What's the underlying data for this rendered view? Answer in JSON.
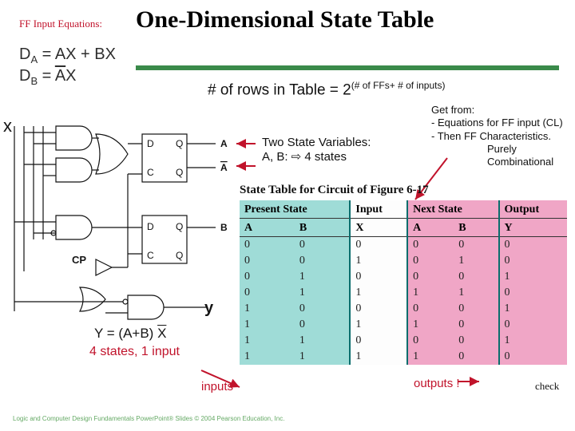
{
  "title": "One-Dimensional State Table",
  "ff_label": "FF Input Equations:",
  "equations": {
    "line1_pre": "D",
    "line1_sub": "A",
    "line1_post": " = AX + BX",
    "line2_pre": "D",
    "line2_sub": "B",
    "line2_eq": " = ",
    "line2_over": "A",
    "line2_end": "X"
  },
  "rows_line": {
    "pre": "# of rows in Table = 2",
    "sup": "(# of FFs+ # of inputs)"
  },
  "two_state": {
    "l1": "Two State Variables:",
    "l2": "A, B: ⇨ 4 states"
  },
  "get_from": {
    "l0": "Get from:",
    "l1": "- Equations for FF input (CL)",
    "l2": "- Then FF Characteristics.",
    "l3": "Purely",
    "l4": "Combinational"
  },
  "circuit_labels": {
    "x": "x",
    "cp": "CP",
    "y": "y",
    "A": "A",
    "Abar": "A",
    "B": "B",
    "D": "D",
    "Q": "Q",
    "C": "C"
  },
  "y_eq_pre": "Y = (A+B) ",
  "y_eq_over": "X",
  "four_states": "4 states, 1 input",
  "inputs_label": "inputs",
  "outputs_label": "outputs !",
  "check_label": "check",
  "logo": "Logic and Computer Design Fundamentals\nPowerPoint® Slides\n© 2004 Pearson Education, Inc.",
  "table": {
    "title": "State Table for Circuit of Figure 6-17",
    "headers1": [
      "Present State",
      "Input",
      "Next State",
      "Output"
    ],
    "headers2": [
      "A",
      "B",
      "X",
      "A",
      "B",
      "Y"
    ],
    "rows": [
      [
        "0",
        "0",
        "0",
        "0",
        "0",
        "0"
      ],
      [
        "0",
        "0",
        "1",
        "0",
        "1",
        "0"
      ],
      [
        "0",
        "1",
        "0",
        "0",
        "0",
        "1"
      ],
      [
        "0",
        "1",
        "1",
        "1",
        "1",
        "0"
      ],
      [
        "1",
        "0",
        "0",
        "0",
        "0",
        "1"
      ],
      [
        "1",
        "0",
        "1",
        "1",
        "0",
        "0"
      ],
      [
        "1",
        "1",
        "0",
        "0",
        "0",
        "1"
      ],
      [
        "1",
        "1",
        "1",
        "1",
        "0",
        "0"
      ]
    ]
  }
}
